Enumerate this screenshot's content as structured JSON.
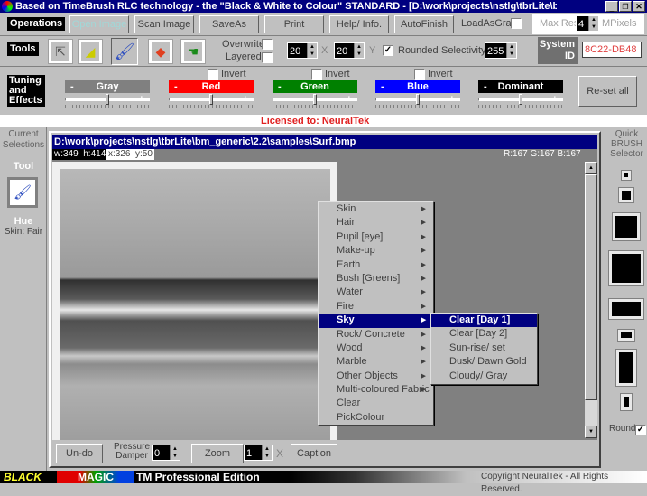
{
  "window": {
    "title": "Based on TimeBrush RLC technology - the \"Black & White to Colour\" STANDARD - [D:\\work\\projects\\nstlg\\tbrLite\\bm_gener...",
    "controls": [
      "minimize",
      "restore",
      "close"
    ]
  },
  "operations": {
    "label": "Operations",
    "buttons": [
      "Open Image",
      "Scan Image",
      "SaveAs",
      "Print",
      "Help/ Info.",
      "AutoFinish"
    ],
    "load_as_gray_label": "LoadAsGray",
    "load_as_gray_checked": false,
    "max_res_label": "Max Res",
    "max_res_value": "4",
    "max_res_unit": "MPixels"
  },
  "tools": {
    "label": "Tools",
    "icons": [
      "arrow-pointer-icon",
      "eraser-icon",
      "brush-icon",
      "fill-bucket-icon",
      "hand-icon"
    ],
    "selected_tool": 2,
    "overwrite_label": "Overwrite",
    "overwrite_checked": false,
    "layered_label": "Layered",
    "layered_checked": false,
    "x_value": "20",
    "x_label": "X",
    "y_value": "20",
    "y_label": "Y",
    "rounded_label": "Rounded",
    "rounded_checked": true,
    "selectivity_label": "Selectivity",
    "selectivity_value": "255",
    "system_id_label": "System ID",
    "system_id_value": "8C22-DB48"
  },
  "tuning": {
    "label": "Tuning and Effects",
    "invert_label": "Invert",
    "sliders": [
      {
        "name": "Gray",
        "color": "#808080",
        "value": 0.5,
        "has_invert": false
      },
      {
        "name": "Red",
        "color": "#ff0000",
        "value": 0.5,
        "has_invert": true
      },
      {
        "name": "Green",
        "color": "#008000",
        "value": 0.5,
        "has_invert": true
      },
      {
        "name": "Blue",
        "color": "#0000ff",
        "value": 0.5,
        "has_invert": true
      },
      {
        "name": "Dominant",
        "color": "#000000",
        "value": 0.5,
        "has_invert": false
      }
    ],
    "minus": "-",
    "plus": "+",
    "reset_label": "Re-set all"
  },
  "license": "Licensed to: NeuralTek",
  "left_panel": {
    "current_selections": "Current Selections",
    "tool_label": "Tool",
    "hue_label": "Hue",
    "hue_value": "Skin: Fair"
  },
  "image_window": {
    "path": "D:\\work\\projects\\nstlg\\tbrLite\\bm_generic\\2.2\\samples\\Surf.bmp",
    "size_readout": "w:349  h:414",
    "pos_readout": "x:326  y:50",
    "rgb_readout": "R:167 G:167 B:167"
  },
  "context_menu": {
    "items": [
      {
        "label": "Skin",
        "submenu": true
      },
      {
        "label": "Hair",
        "submenu": true
      },
      {
        "label": "Pupil [eye]",
        "submenu": true
      },
      {
        "label": "Make-up",
        "submenu": true
      },
      {
        "label": "Earth",
        "submenu": true
      },
      {
        "label": "Bush [Greens]",
        "submenu": true
      },
      {
        "label": "Water",
        "submenu": true
      },
      {
        "label": "Fire",
        "submenu": true
      },
      {
        "label": "Sky",
        "submenu": true,
        "selected": true
      },
      {
        "label": "Rock/ Concrete",
        "submenu": true
      },
      {
        "label": "Wood",
        "submenu": true
      },
      {
        "label": "Marble",
        "submenu": true
      },
      {
        "label": "Other Objects",
        "submenu": true
      },
      {
        "label": "Multi-coloured Fabric",
        "submenu": true
      },
      {
        "label": "Clear",
        "submenu": false
      },
      {
        "label": "PickColour",
        "submenu": false
      }
    ],
    "submenu": [
      {
        "label": "Clear [Day 1]",
        "selected": true
      },
      {
        "label": "Clear [Day 2]"
      },
      {
        "label": "Sun-rise/ set"
      },
      {
        "label": "Dusk/ Dawn Gold"
      },
      {
        "label": "Cloudy/ Gray"
      }
    ]
  },
  "bottom_bar": {
    "undo_label": "Un-do",
    "pressure_label": "Pressure Damper",
    "pressure_value": "0",
    "zoom_label": "Zoom",
    "zoom_value": "1",
    "zoom_unit": "X",
    "caption_label": "Caption"
  },
  "brush_selector": {
    "title": "Quick BRUSH Selector",
    "round_label": "Round",
    "round_checked": true
  },
  "footer": {
    "logo_black": "BLACK",
    "logo_magic": "MAGIC",
    "edition": "TM Professional Edition",
    "copyright": "Copyright NeuralTek - All Rights Reserved."
  }
}
